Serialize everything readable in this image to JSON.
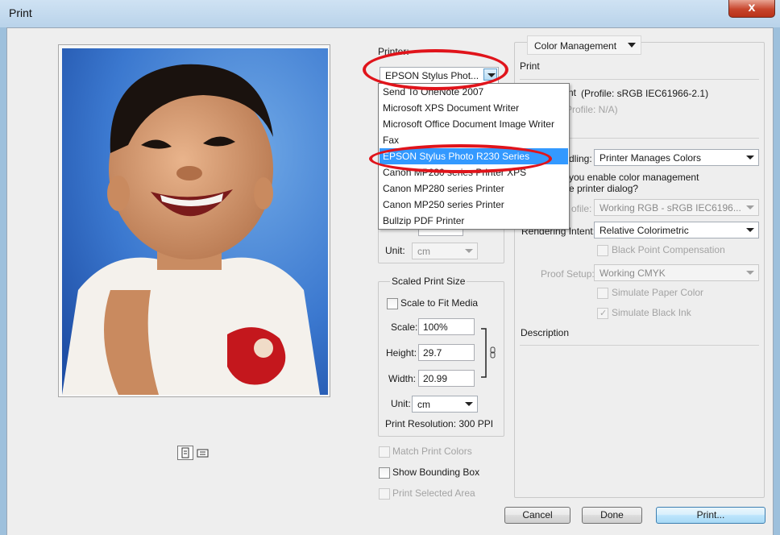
{
  "window": {
    "title": "Print",
    "close_label": "x"
  },
  "printer": {
    "label": "Printer:",
    "selected": "EPSON Stylus Phot...",
    "options": [
      "Send To OneNote 2007",
      "Microsoft XPS Document Writer",
      "Microsoft Office Document Image Writer",
      "Fax",
      "EPSON Stylus Photo R230 Series",
      "Canon MP280 series Printer XPS",
      "Canon MP280 series Printer",
      "Canon MP250 series Printer",
      "Bullzip PDF Printer"
    ],
    "highlighted_index": 4
  },
  "position": {
    "unit_label": "Unit:",
    "unit_value": "cm"
  },
  "scaled_print_size": {
    "legend": "Scaled Print Size",
    "scale_to_fit_label": "Scale to Fit Media",
    "scale_label": "Scale:",
    "scale_value": "100%",
    "height_label": "Height:",
    "height_value": "29.7",
    "width_label": "Width:",
    "width_value": "20.99",
    "unit_label": "Unit:",
    "unit_value": "cm",
    "resolution": "Print Resolution: 300 PPI"
  },
  "options": {
    "match_print_colors": "Match Print Colors",
    "show_bounding_box": "Show Bounding Box",
    "print_selected_area": "Print Selected Area"
  },
  "color_management": {
    "menu_label": "Color Management",
    "print_heading": "Print",
    "document_suffix": "nt",
    "document_profile": "(Profile: sRGB IEC61966-2.1)",
    "proof_profile": "Profile: N/A)",
    "color_handling_label": "dling:",
    "color_handling_value": "Printer Manages Colors",
    "reminder_line1": "you enable color management",
    "reminder_line2": "e printer dialog?",
    "printer_profile_label": "ofile:",
    "printer_profile_value": "Working RGB - sRGB IEC6196...",
    "rendering_intent_label": "Rendering Intent:",
    "rendering_intent_value": "Relative Colorimetric",
    "black_point_label": "Black Point Compensation",
    "proof_setup_label": "Proof Setup:",
    "proof_setup_value": "Working CMYK",
    "simulate_paper_label": "Simulate Paper Color",
    "simulate_black_label": "Simulate Black Ink",
    "description_heading": "Description"
  },
  "buttons": {
    "cancel": "Cancel",
    "done": "Done",
    "print": "Print..."
  },
  "colors": {
    "selection": "#3399ff",
    "annotation": "#e0141b",
    "dialog_bg": "#eeeeee"
  },
  "icons": [
    "portrait-orientation-icon",
    "landscape-orientation-icon",
    "link-chain-icon",
    "chevron-down-icon"
  ]
}
